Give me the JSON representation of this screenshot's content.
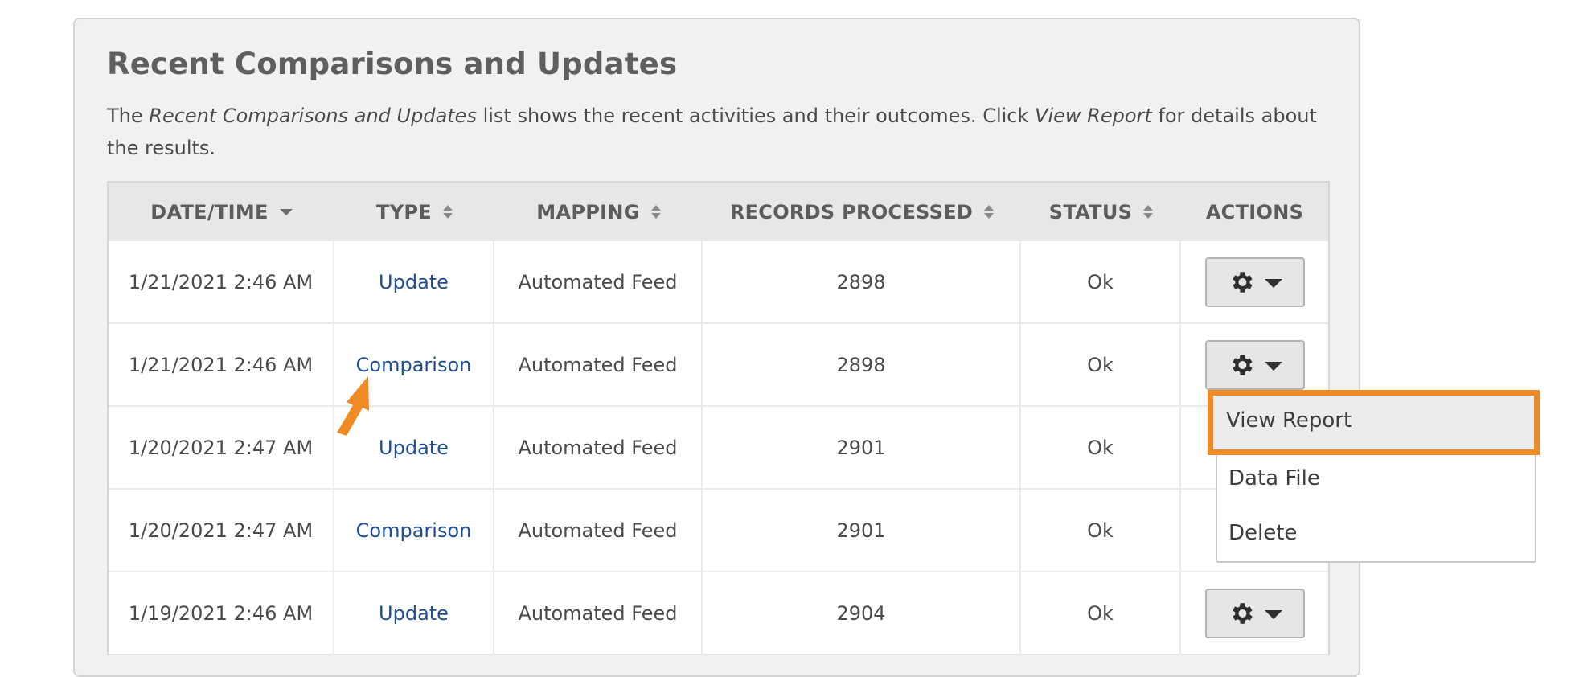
{
  "section": {
    "title": "Recent Comparisons and Updates",
    "desc_1": "The ",
    "desc_em1": "Recent Comparisons and Updates",
    "desc_2": " list shows the recent activities and their outcomes. Click ",
    "desc_em2": "View Report",
    "desc_3": " for details about the results."
  },
  "table": {
    "headers": {
      "datetime": "DATE/TIME",
      "type": "TYPE",
      "mapping": "MAPPING",
      "records": "RECORDS PROCESSED",
      "status": "STATUS",
      "actions": "ACTIONS"
    },
    "rows": [
      {
        "datetime": "1/21/2021 2:46 AM",
        "type": "Update",
        "mapping": "Automated Feed",
        "records": "2898",
        "status": "Ok"
      },
      {
        "datetime": "1/21/2021 2:46 AM",
        "type": "Comparison",
        "mapping": "Automated Feed",
        "records": "2898",
        "status": "Ok"
      },
      {
        "datetime": "1/20/2021 2:47 AM",
        "type": "Update",
        "mapping": "Automated Feed",
        "records": "2901",
        "status": "Ok"
      },
      {
        "datetime": "1/20/2021 2:47 AM",
        "type": "Comparison",
        "mapping": "Automated Feed",
        "records": "2901",
        "status": "Ok"
      },
      {
        "datetime": "1/19/2021 2:46 AM",
        "type": "Update",
        "mapping": "Automated Feed",
        "records": "2904",
        "status": "Ok"
      }
    ]
  },
  "actions_menu": {
    "items": [
      "View Report",
      "Data File",
      "Delete"
    ]
  },
  "colors": {
    "link": "#1f4e94",
    "highlight": "#ef8a25",
    "panel_bg": "#f1f1f1",
    "header_bg": "#e7e7e7"
  },
  "icons": {
    "sort_active": "caret-down-icon",
    "sort_both": "sort-icon",
    "action": "gear-icon",
    "dropdown": "caret-down-icon",
    "annotation": "arrow-icon"
  }
}
